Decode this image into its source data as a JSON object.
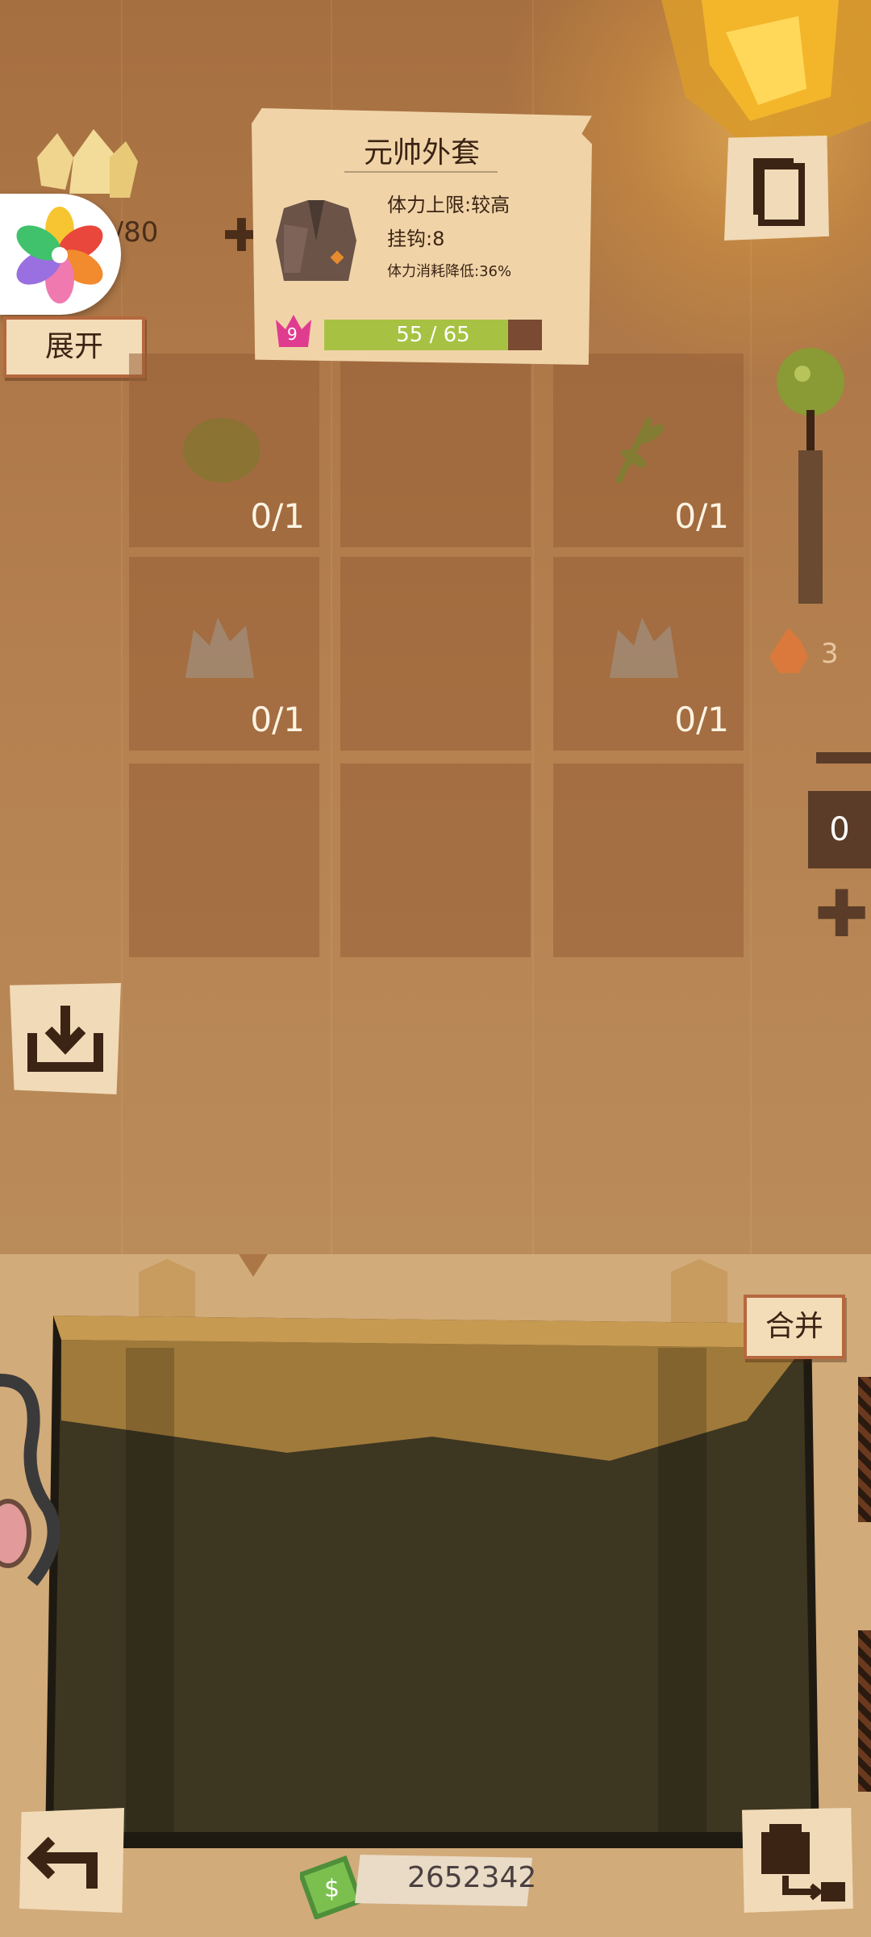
{
  "resource": {
    "count": "3/80",
    "plus": "✚"
  },
  "sidebar": {
    "expand_label": "展开"
  },
  "tooltip": {
    "title": "元帅外套",
    "stats": [
      "体力上限:较高",
      "挂钩:8",
      "体力消耗降低:36%"
    ],
    "level": "9",
    "durability_text": "55 / 65",
    "durability_fraction": 0.846
  },
  "grid": {
    "slots": [
      {
        "count": "0/1",
        "icon": "bag-icon"
      },
      {
        "count": "",
        "icon": ""
      },
      {
        "count": "0/1",
        "icon": "herb-icon"
      },
      {
        "count": "0/1",
        "icon": "fur-icon"
      },
      {
        "count": "",
        "icon": ""
      },
      {
        "count": "0/1",
        "icon": "fur-icon"
      },
      {
        "count": "",
        "icon": ""
      },
      {
        "count": "",
        "icon": ""
      },
      {
        "count": "",
        "icon": ""
      }
    ]
  },
  "right_panel": {
    "flame_count": "3",
    "counter_value": "0",
    "minus": "—",
    "plus": "✚"
  },
  "bottom": {
    "merge_label": "合并",
    "money": "2652342"
  },
  "colors": {
    "accent_green": "#a7c243",
    "bar_empty": "#7a4b32",
    "paper": "#f0d4a8"
  }
}
